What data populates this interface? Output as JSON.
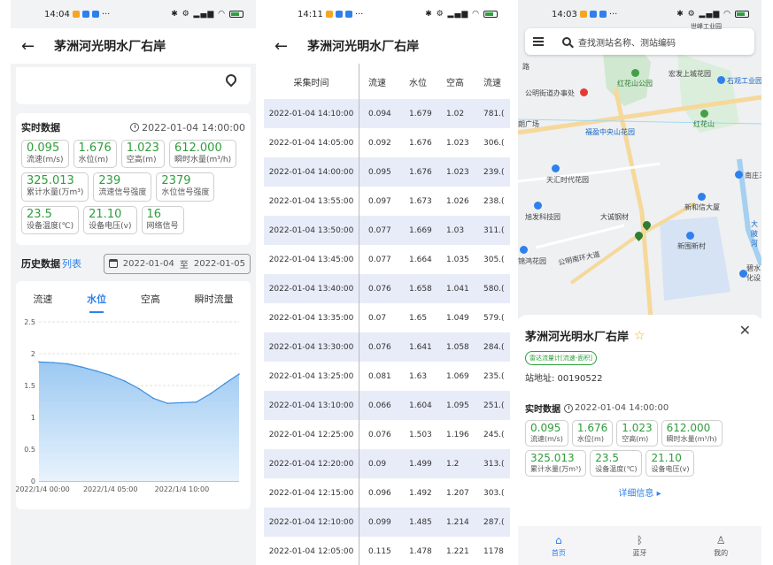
{
  "screen1": {
    "status_time": "14:04",
    "status_more": "···",
    "title": "茅洲河光明水厂右岸",
    "realtime": {
      "title": "实时数据",
      "time": "2022-01-04 14:00:00",
      "chips": [
        {
          "value": "0.095",
          "label": "流速(m/s)"
        },
        {
          "value": "1.676",
          "label": "水位(m)"
        },
        {
          "value": "1.023",
          "label": "空高(m)"
        },
        {
          "value": "612.000",
          "label": "瞬时水量(m³/h)"
        },
        {
          "value": "325.013",
          "label": "累计水量(万m³)"
        },
        {
          "value": "239",
          "label": "流速信号强度"
        },
        {
          "value": "2379",
          "label": "水位信号强度"
        },
        {
          "value": "23.5",
          "label": "设备温度(℃)"
        },
        {
          "value": "21.10",
          "label": "设备电压(v)"
        },
        {
          "value": "16",
          "label": "网络信号"
        }
      ]
    },
    "history": {
      "title": "历史数据",
      "link": "列表",
      "date_from": "2022-01-04",
      "date_sep": "至",
      "date_to": "2022-01-05"
    },
    "tabs": [
      "流速",
      "水位",
      "空高",
      "瞬时流量"
    ],
    "active_tab": 1
  },
  "chart_data": {
    "type": "area",
    "title": "",
    "xlabel": "",
    "ylabel": "",
    "ylim": [
      0,
      2.5
    ],
    "yticks": [
      0,
      0.5,
      1,
      1.5,
      2,
      2.5
    ],
    "ytick_labels": [
      "0",
      "0.5",
      "1",
      "1.5",
      "2",
      "2.5"
    ],
    "xtick_labels": [
      "2022/1/4 00:00",
      "2022/1/4 05:00",
      "2022/1/4 10:00"
    ],
    "x_hours": [
      0,
      1,
      2,
      3,
      4,
      5,
      6,
      7,
      8,
      9,
      10,
      11,
      12,
      13,
      14
    ],
    "values": [
      1.87,
      1.86,
      1.84,
      1.79,
      1.73,
      1.66,
      1.57,
      1.45,
      1.3,
      1.22,
      1.23,
      1.24,
      1.37,
      1.53,
      1.68
    ],
    "color": "#3b8fe0",
    "grid": true
  },
  "screen2": {
    "status_time": "14:11",
    "status_more": "···",
    "title": "茅洲河光明水厂右岸",
    "columns": [
      "采集时间",
      "流速",
      "水位",
      "空高",
      "流速"
    ],
    "rows": [
      [
        "2022-01-04 14:10:00",
        "0.094",
        "1.679",
        "1.02",
        "781.("
      ],
      [
        "2022-01-04 14:05:00",
        "0.092",
        "1.676",
        "1.023",
        "306.("
      ],
      [
        "2022-01-04 14:00:00",
        "0.095",
        "1.676",
        "1.023",
        "239.("
      ],
      [
        "2022-01-04 13:55:00",
        "0.097",
        "1.673",
        "1.026",
        "238.("
      ],
      [
        "2022-01-04 13:50:00",
        "0.077",
        "1.669",
        "1.03",
        "311.("
      ],
      [
        "2022-01-04 13:45:00",
        "0.077",
        "1.664",
        "1.035",
        "305.("
      ],
      [
        "2022-01-04 13:40:00",
        "0.076",
        "1.658",
        "1.041",
        "580.("
      ],
      [
        "2022-01-04 13:35:00",
        "0.07",
        "1.65",
        "1.049",
        "579.("
      ],
      [
        "2022-01-04 13:30:00",
        "0.076",
        "1.641",
        "1.058",
        "284.("
      ],
      [
        "2022-01-04 13:25:00",
        "0.081",
        "1.63",
        "1.069",
        "235.("
      ],
      [
        "2022-01-04 13:10:00",
        "0.066",
        "1.604",
        "1.095",
        "251.("
      ],
      [
        "2022-01-04 12:25:00",
        "0.076",
        "1.503",
        "1.196",
        "245.("
      ],
      [
        "2022-01-04 12:20:00",
        "0.09",
        "1.499",
        "1.2",
        "313.("
      ],
      [
        "2022-01-04 12:15:00",
        "0.096",
        "1.492",
        "1.207",
        "303.("
      ],
      [
        "2022-01-04 12:10:00",
        "0.099",
        "1.485",
        "1.214",
        "287.("
      ],
      [
        "2022-01-04 12:05:00",
        "0.115",
        "1.478",
        "1.221",
        "1178"
      ]
    ]
  },
  "screen3": {
    "status_time": "14:03",
    "status_more": "···",
    "search_placeholder": "查找测站名称、测站编码",
    "pois": {
      "p1": "宏发上城花园",
      "p2": "石观工业园",
      "p3": "红花山公园",
      "p4": "公明街道办事处",
      "p5": "红花山",
      "p6": "福盈中央山花园",
      "p7": "天汇时代花园",
      "p8": "南庄三",
      "p9": "新和信大厦",
      "p10": "旭发科技园",
      "p11": "大诚钢材",
      "p12": "新围新村",
      "p13": "锦鸿花园",
      "p14": "公明南环大道",
      "p15": "碧水化设",
      "p16": "朗广场",
      "p17": "路",
      "p18": "世峰工业园",
      "p19": "大陂河"
    },
    "station_name": "茅洲河光明水厂右岸",
    "tag": "雷达流量计[流速-面积]",
    "address": "站地址: 00190522",
    "rt_title": "实时数据",
    "rt_time": "2022-01-04 14:00:00",
    "chips": [
      {
        "value": "0.095",
        "label": "流速(m/s)"
      },
      {
        "value": "1.676",
        "label": "水位(m)"
      },
      {
        "value": "1.023",
        "label": "空高(m)"
      },
      {
        "value": "612.000",
        "label": "瞬时水量(m³/h)"
      },
      {
        "value": "325.013",
        "label": "累计水量(万m³)"
      },
      {
        "value": "23.5",
        "label": "设备温度(℃)"
      },
      {
        "value": "21.10",
        "label": "设备电压(v)"
      }
    ],
    "more": "详细信息 ▸",
    "nav": [
      {
        "label": "首页",
        "icon": "home-icon"
      },
      {
        "label": "蓝牙",
        "icon": "bluetooth-icon"
      },
      {
        "label": "我的",
        "icon": "person-icon"
      }
    ]
  }
}
